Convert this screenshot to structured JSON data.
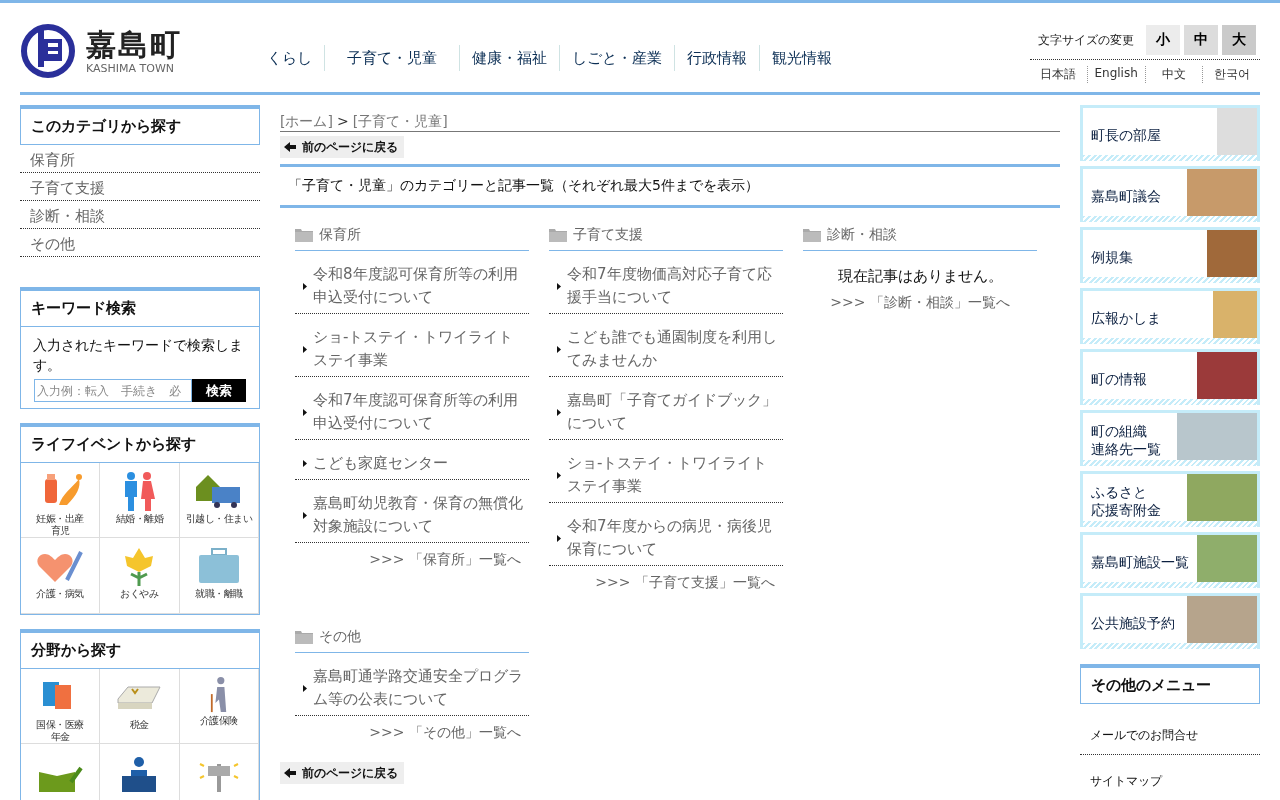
{
  "header": {
    "logo_title": "嘉島町",
    "logo_subtitle": "KASHIMA TOWN",
    "nav": [
      "くらし",
      "子育て・児童",
      "健康・福祉",
      "しごと・産業",
      "行政情報",
      "観光情報"
    ],
    "font_size": {
      "label": "文字サイズの変更",
      "options": [
        "小",
        "中",
        "大"
      ]
    },
    "languages": [
      "日本語",
      "English",
      "中文",
      "한국어"
    ]
  },
  "left_sidebar": {
    "category": {
      "title": "このカテゴリから探す",
      "items": [
        "保育所",
        "子育て支援",
        "診断・相談",
        "その他"
      ]
    },
    "keyword_search": {
      "title": "キーワード検索",
      "description": "入力されたキーワードで検索します。",
      "placeholder": "入力例：転入　手続き　必",
      "button": "検索"
    },
    "life_events": {
      "title": "ライフイベントから探す",
      "items": [
        {
          "kind": "baby",
          "label": [
            "妊娠・出産",
            "育児"
          ]
        },
        {
          "kind": "couple",
          "label": "結婚・離婚"
        },
        {
          "kind": "moving",
          "label": "引越し・住まい"
        },
        {
          "kind": "health",
          "label": "介護・病気"
        },
        {
          "kind": "flower",
          "label": "おくやみ"
        },
        {
          "kind": "job",
          "label": "就職・離職"
        }
      ]
    },
    "fields": {
      "title": "分野から探す",
      "items": [
        {
          "kind": "insurance",
          "label": [
            "国保・医療",
            "年金"
          ]
        },
        {
          "kind": "tax",
          "label": "税金"
        },
        {
          "kind": "care",
          "label": "介護保険"
        },
        {
          "kind": "education"
        },
        {
          "kind": "counter"
        },
        {
          "kind": "speaker"
        }
      ]
    }
  },
  "main": {
    "breadcrumb": {
      "home": "[ホーム]",
      "separator": ">",
      "current": "[子育て・児童]"
    },
    "back_button": "前のページに戻る",
    "heading": "「子育て・児童」のカテゴリーと記事一覧（それぞれ最大5件までを表示）",
    "categories": [
      {
        "title": "保育所",
        "articles": [
          "令和8年度認可保育所等の利用申込受付について",
          "ショ-トステイ・トワイライトステイ事業",
          "令和7年度認可保育所等の利用申込受付について",
          "こども家庭センター",
          "嘉島町幼児教育・保育の無償化対象施設について"
        ],
        "more_link": ">>> 「保育所」一覧へ"
      },
      {
        "title": "子育て支援",
        "articles": [
          "令和7年度物価高対応子育て応援手当について",
          "こども誰でも通園制度を利用してみませんか",
          "嘉島町「子育てガイドブック」について",
          "ショ-トステイ・トワイライトステイ事業",
          "令和7年度からの病児・病後児保育について"
        ],
        "more_link": ">>> 「子育て支援」一覧へ"
      },
      {
        "title": "診断・相談",
        "empty_message": "現在記事はありません。",
        "more_link": ">>> 「診断・相談」一覧へ"
      },
      {
        "title": "その他",
        "articles": [
          "嘉島町通学路交通安全プログラム等の公表について"
        ],
        "more_link": ">>> 「その他」一覧へ"
      }
    ],
    "back_button_bottom": "前のページに戻る"
  },
  "right_sidebar": {
    "banners": [
      {
        "kind": "portrait",
        "label": "町長の部屋"
      },
      {
        "kind": "hall",
        "label": "嘉島町議会"
      },
      {
        "kind": "books",
        "label": "例規集"
      },
      {
        "kind": "magazine",
        "label": "広報かしま"
      },
      {
        "kind": "building",
        "label": "町の情報"
      },
      {
        "kind": "office",
        "label": [
          "町の組織",
          "連絡先一覧"
        ]
      },
      {
        "kind": "food",
        "label": [
          "ふるさと",
          "応援寄附金"
        ]
      },
      {
        "kind": "landscape",
        "label": "嘉島町施設一覧"
      },
      {
        "kind": "facility",
        "label": "公共施設予約"
      }
    ],
    "other_menu": {
      "title": "その他のメニュー",
      "items": [
        "メールでのお問合せ",
        "サイトマップ"
      ]
    }
  }
}
